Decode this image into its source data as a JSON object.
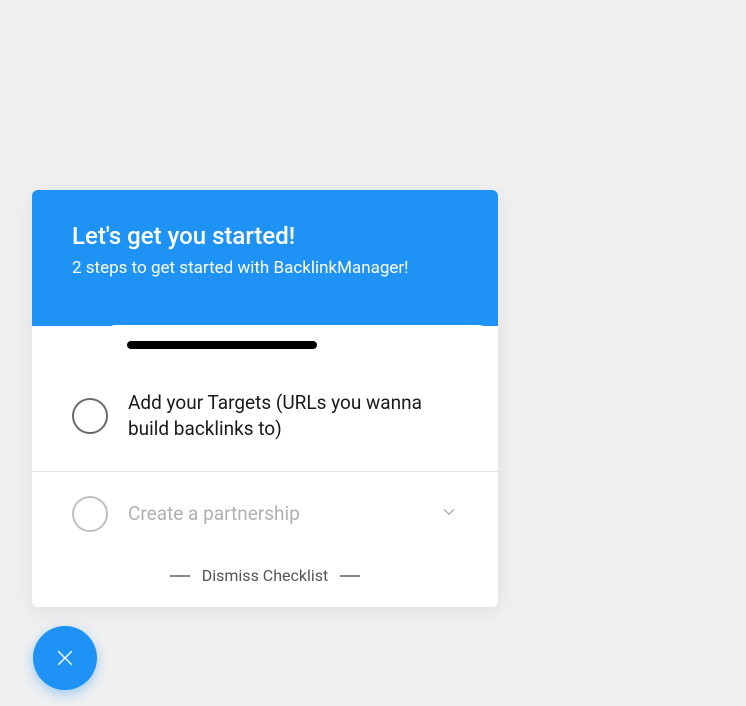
{
  "header": {
    "title": "Let's get you started!",
    "subtitle": "2 steps to get started with BacklinkManager!"
  },
  "items": [
    {
      "label": "Add your Targets (URLs you wanna build backlinks to)",
      "active": true,
      "expandable": false
    },
    {
      "label": "Create a partnership",
      "active": false,
      "expandable": true
    }
  ],
  "dismiss": {
    "label": "Dismiss Checklist"
  },
  "fab": {
    "icon": "close-icon"
  }
}
